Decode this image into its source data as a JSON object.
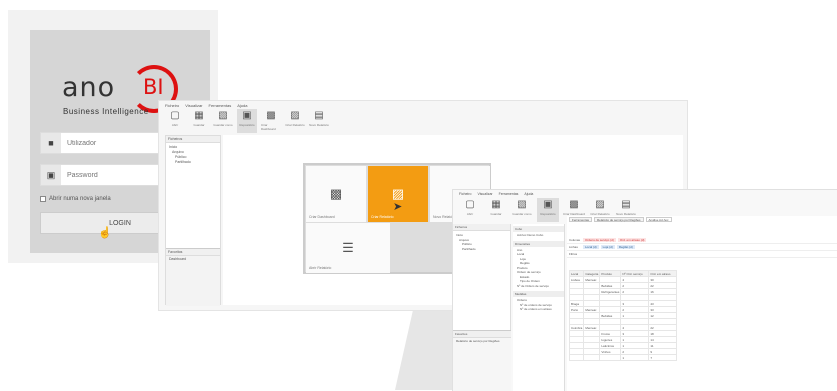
{
  "login": {
    "logo_text": "ano",
    "logo_bi": "BI",
    "logo_subtitle": "Business Intelligence",
    "user_placeholder": "Utilizador",
    "password_placeholder": "Password",
    "new_window_label": "Abrir numa nova janela",
    "login_label": "LOGIN"
  },
  "app": {
    "menu": [
      "Ficheiro",
      "Visualizar",
      "Ferramentas",
      "Ajuda"
    ],
    "toolbar": [
      "Abrir",
      "Guardar",
      "Guardar como",
      "Repositório",
      "Criar Dashboard",
      "Criar Relatório",
      "Novo Relatório"
    ],
    "sidebar_header": "Ficheiros",
    "tree": [
      "Inicio",
      "Arquivo",
      "Público",
      "Partilhado"
    ],
    "favorites_header": "Favoritos",
    "favorite_item": "Dashboard"
  },
  "tiles": {
    "dashboard_label": "Criar Dashboard",
    "report_label": "Criar Relatório",
    "tile3_label": "Novo Relatório",
    "tile4_label": "Abrir Relatório"
  },
  "report": {
    "tabs": [
      "Ferramentas",
      "Relatório de serviço por Regiões",
      "Análise Ad-hoc"
    ],
    "sidebar_header": "Ficheiros",
    "favorites_header": "Favoritos",
    "favorite_item": "Relatório de serviço por Regiões",
    "datasource_header": "Cubo",
    "datasource_value": "Ad-hoc Demo Cubo",
    "dimensions_header": "Dimensões",
    "dimensions": [
      "Ano",
      "Local",
      "Loja",
      "Região",
      "Produto",
      "Ordem de serviço",
      "Estado",
      "Tipo de Ordem",
      "Nº de Ordem de serviço"
    ],
    "measures_header": "Medidas",
    "measures": [
      "Ordens",
      "Nº de ordens de serviço",
      "Nº de ordens em atraso"
    ],
    "rows_label": "Colunas",
    "rows_pills": [
      "Ordens de serviço (d)",
      "Ord. em atraso (d)"
    ],
    "cols_label": "Linhas",
    "cols_pills": [
      "Local (d)",
      "Loja (d)",
      "Região (d)"
    ],
    "filters_label": "Filtros",
    "table": {
      "headers": [
        "Local",
        "Categoria",
        "Produto",
        "Nº Ord. serviço",
        "Ord. em atraso"
      ],
      "rows": [
        [
          "Lisboa",
          "Mercear.",
          "",
          "4",
          "30"
        ],
        [
          "",
          "",
          "Bebidas",
          "2",
          "22"
        ],
        [
          "",
          "",
          "Refrigerantes",
          "2",
          "16"
        ],
        [
          "",
          "",
          "",
          "",
          ""
        ],
        [
          "Braga",
          "",
          "",
          "3",
          "43"
        ],
        [
          "Porto",
          "Mercear.",
          "",
          "2",
          "33"
        ],
        [
          "",
          "",
          "Bebidas",
          "1",
          "12"
        ],
        [
          "",
          "",
          "",
          "",
          ""
        ],
        [
          "Coimbra",
          "Mercear.",
          "",
          "4",
          "22"
        ],
        [
          "",
          "",
          "Frutos",
          "3",
          "18"
        ],
        [
          "",
          "",
          "Iogurtes",
          "1",
          "14"
        ],
        [
          "",
          "",
          "Laticínios",
          "1",
          "11"
        ],
        [
          "",
          "",
          "Vinhos",
          "2",
          "9"
        ],
        [
          "",
          "",
          "",
          "1",
          "7"
        ]
      ]
    }
  }
}
